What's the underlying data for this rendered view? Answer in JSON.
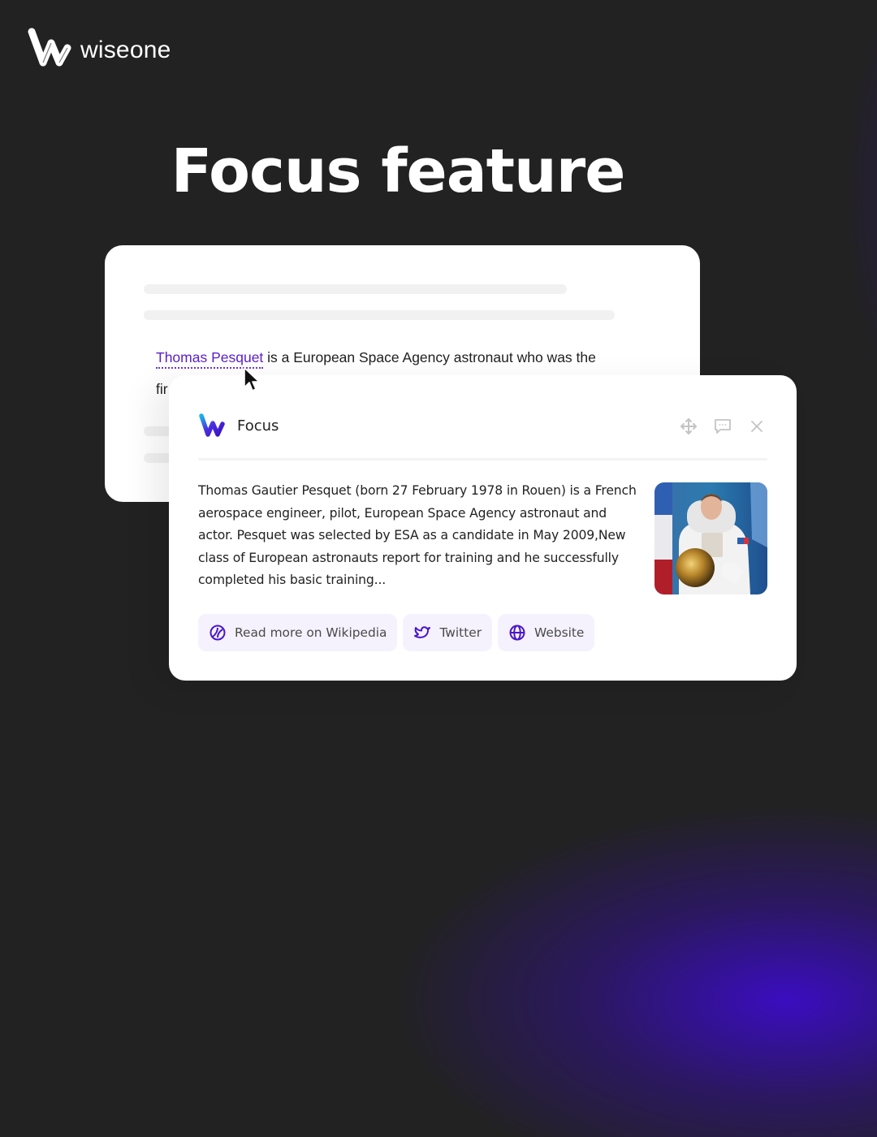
{
  "brand": {
    "name": "wiseone",
    "logo_icon": "wiseone-w-logo"
  },
  "hero": {
    "title": "Focus feature"
  },
  "document": {
    "highlighted_term": "Thomas Pesquet",
    "sentence_rest": " is a European Space Agency astronaut who was the",
    "second_line_fragment": "fir",
    "link_color": "#5b1fc9"
  },
  "focus_panel": {
    "title": "Focus",
    "header_actions": [
      {
        "icon": "move-icon",
        "label": "Move"
      },
      {
        "icon": "comment-icon",
        "label": "Comment"
      },
      {
        "icon": "close-icon",
        "label": "Close"
      }
    ],
    "summary": "Thomas Gautier Pesquet (born 27 February 1978 in Rouen) is a French aerospace engineer, pilot, European Space Agency astronaut and actor. Pesquet was selected by ESA as a candidate in May 2009,New class of European astronauts report for training and he successfully completed his basic training...",
    "image_alt": "Thomas Pesquet in spacesuit",
    "links": [
      {
        "icon": "wikipedia-globe-icon",
        "label": "Read more on Wikipedia"
      },
      {
        "icon": "twitter-bird-icon",
        "label": "Twitter"
      },
      {
        "icon": "website-globe-icon",
        "label": "Website"
      }
    ],
    "accent_color": "#4a16c9",
    "pill_bg": "#f5f2fe"
  },
  "colors": {
    "background": "#222222",
    "glow": "#3a0eb4"
  }
}
